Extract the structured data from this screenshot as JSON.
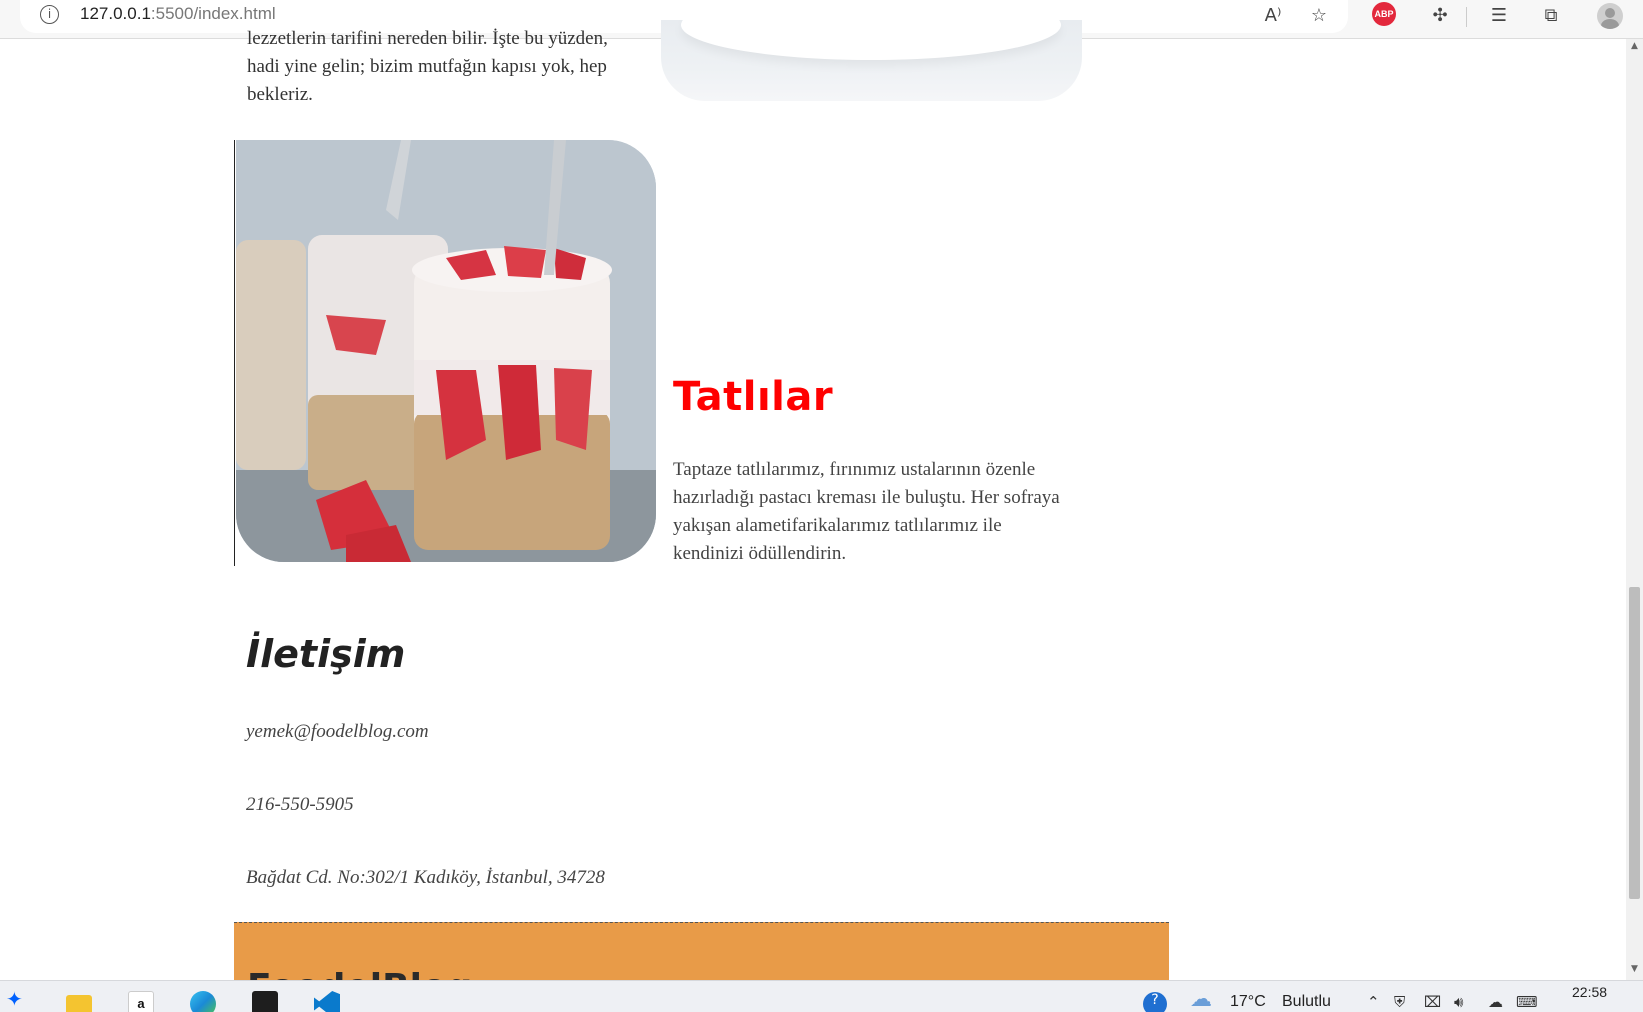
{
  "browser": {
    "url_host": "127.0.0.1",
    "url_rest": ":5500/index.html",
    "icons": [
      "info-icon",
      "read-aloud-icon",
      "add-favorite-icon",
      "adblock-icon",
      "extensions-icon",
      "favorites-icon",
      "collections-icon",
      "profile-icon"
    ],
    "read_aloud_glyph": "A⁾",
    "adblock_label": "ABP"
  },
  "top_section": {
    "text_lines": [
      "lezzetlerin tarifini nereden bilir. İşte bu yüzden,",
      "hadi yine gelin; bizim mutfağın kapısı yok, hep",
      "bekleriz."
    ]
  },
  "dessert_section": {
    "title": "Tatlılar",
    "body": "Taptaze tatlılarımız, fırınımız ustalarının özenle hazırladığı pastacı kreması ile buluştu. Her sofraya yakışan alametifarikalarımız tatlılarımız ile kendinizi ödüllendirin."
  },
  "contact": {
    "title": "İletişim",
    "email": "yemek@foodelblog.com",
    "phone": "216-550-5905",
    "address": "Bağdat Cd. No:302/1 Kadıköy, İstanbul, 34728"
  },
  "footer": {
    "title": "FoodelBlog"
  },
  "taskbar": {
    "apps": [
      "dropbox-icon",
      "file-explorer-icon",
      "amazon-icon",
      "edge-icon",
      "terminal-icon",
      "vscode-icon"
    ],
    "amazon_glyph": "a",
    "weather_temp": "17°C",
    "weather_text": "Bulutlu",
    "time": "22:58",
    "colors": {
      "taskbar_bg": "#eef0f4",
      "footer_bg": "#e89b48",
      "section_title": "#ff0000"
    }
  }
}
